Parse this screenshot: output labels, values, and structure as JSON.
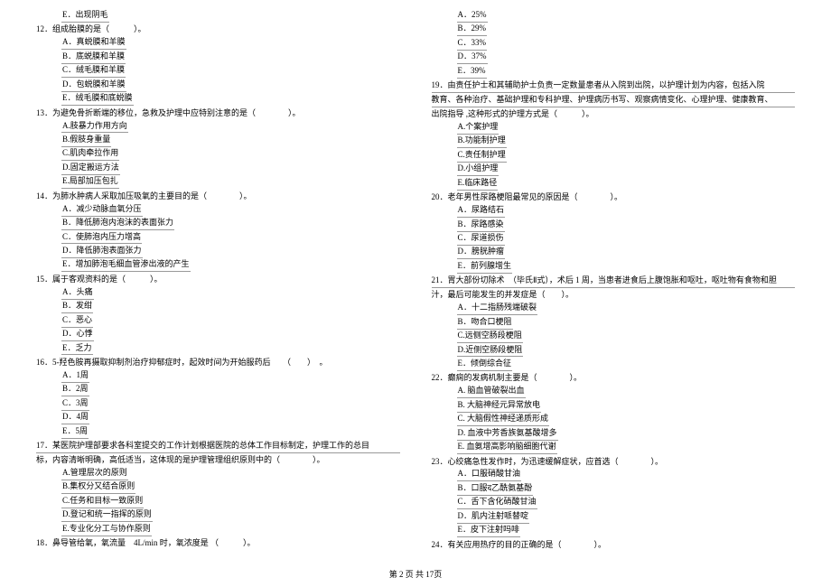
{
  "left": {
    "q11e": "E．出现阴毛",
    "q12": {
      "stem": "12．组成胎膜的是（　　　）。",
      "opts": [
        "A．真蜕膜和羊膜",
        "B．底蜕膜和羊膜",
        "C．绒毛膜和羊膜",
        "D．包蜕膜和羊膜",
        "E．绒毛膜和底蜕膜"
      ]
    },
    "q13": {
      "stem": "13．为避免骨折断端的移位，急救及护理中应特别注意的是（　　　　）。",
      "opts": [
        "A.肢暴力作用方向",
        "B.假肢身重量",
        "C.肌肉牵拉作用",
        "D.固定搬运方法",
        "E.局部加压包扎"
      ]
    },
    "q14": {
      "stem": "14．为肺水肿病人采取加压吸氧的主要目的是（　　　　）。",
      "opts": [
        "A．减少动脉血氧分压",
        "B．降低肺泡内泡沫的表面张力",
        "C．使肺泡内压力增高",
        "D．降低肺泡表面张力",
        "E．增加肺泡毛细血管渗出液的产生"
      ]
    },
    "q15": {
      "stem": "15．属于客观资料的是（　　　）。",
      "opts": [
        "A．头痛",
        "B．发绀",
        "C．恶心",
        "D．心悸",
        "E．乏力"
      ]
    },
    "q16": {
      "stem": "16．5-羟色胺再摄取抑制剂治疗抑郁症时，起效时间为开始服药后　　（　　）　。",
      "opts": [
        "A．1周",
        "B．2周",
        "C．3周",
        "D．4周",
        "E．5周"
      ]
    },
    "q17": {
      "stem1": "17．某医院护理部要求各科室提交的工作计划根据医院的总体工作目标制定，护理工作的总目",
      "stem2": "标，内容清晰明确，高低适当，这体现的是护理管理组织原则中的（　　　　）。",
      "opts": [
        "A.管理层次的原则",
        "B.集权分又结合原则",
        "C.任务和目标一致原则",
        "D.登记和统一指挥的原则",
        "E.专业化分工与协作原则"
      ]
    },
    "q18": {
      "stem": "18．鼻导管给氧，氧流量　4L/min 时，氧浓度是 （　　　）。"
    }
  },
  "right": {
    "q18opts": [
      "A．25%",
      "B．29%",
      "C．33%",
      "D．37%",
      "E．39%"
    ],
    "q19": {
      "stem1": "19．由责任护士和其辅助护士负责一定数量患者从入院到出院，以护理计划为内容，包括入院",
      "stem2": "教育、各种治疗、基础护理和专科护理、护理病历书写、观察病情变化、心理护理、健康教育、",
      "stem3": "出院指导 ,这种形式的护理方式是（　　　）。",
      "opts": [
        "A.个案护理",
        "B.功能制护理",
        "C.责任制护理",
        "D.小组护理",
        "E.临床路径"
      ]
    },
    "q20": {
      "stem": "20．老年男性尿路梗阻最常见的原因是（　　　　）。",
      "opts": [
        "A．尿路结石",
        "B．尿路感染",
        "C．尿道损伤",
        "D．膀胱肿瘤",
        "E．前列腺增生"
      ]
    },
    "q21": {
      "stem1": "21．胃大部份切除术　（毕氏Ⅱ式），术后  1 周，当患者进食后上腹饱胀和呕吐，呕吐物有食物和胆",
      "stem2": "汁，最后可能发生的并发症是（　　）。",
      "opts": [
        "A．十二指肠残端破裂",
        "B．吻合口梗阻",
        "C.远侧空肠段梗阻",
        "D.近侧空肠段梗阻",
        "E．倾倒综合征"
      ]
    },
    "q22": {
      "stem": "22．癫痫的发病机制主要是（　　　　）。",
      "opts": [
        "A. 脑血管破裂出血",
        "B. 大脑神经元异常放电",
        "C. 大脑假性神经递质形成",
        "D. 血液中芳香族氨基酸增多",
        "E. 血氨增高影响脑细胞代谢"
      ]
    },
    "q23": {
      "stem": "23．心绞痛急性发作时，为迅速缓解症状，应首选（　　　　）。",
      "opts": [
        "A．口服硝酸甘油",
        "B．口服द乙酰氨基酚",
        "C．舌下含化硝酸甘油",
        "D．肌内注射哌替啶",
        "E．皮下注射吗啡"
      ]
    },
    "q24": {
      "stem": "24．有关应用热疗的目的正确的是（　　　　）。"
    }
  },
  "pager": "第  2 页  共  17页"
}
